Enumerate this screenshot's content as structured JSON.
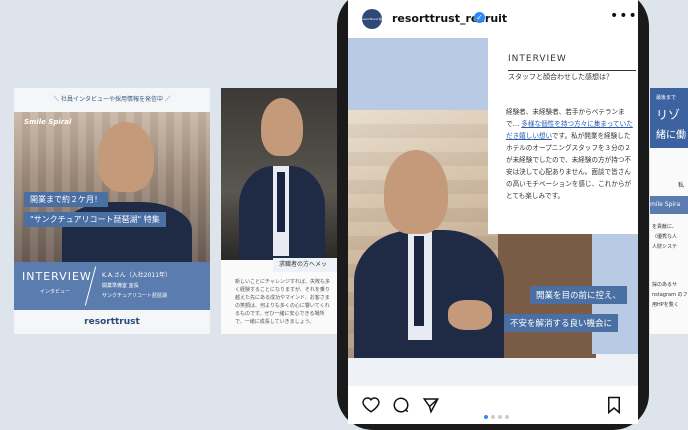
{
  "card1": {
    "top_text": "＼ 社員インタビューや採用情報を発信中 ／",
    "brand": "Smile Spiral",
    "tag1": "開業まで約２ケ月！",
    "tag2": "\"サンクチュアリコート琵琶湖\" 特集",
    "interview": "INTERVIEW",
    "interview_ja": "インタビュー",
    "person": "K.A.さん（入社2011年）",
    "dept": "開業準備室 室長",
    "hotel": "サンクチュアリコート琵琶湖",
    "logo": "resorttrust"
  },
  "card2": {
    "label": "求職者の方へメッ",
    "body": "新しいことにチャレンジすれば、失敗も多く経験することになりますが、それを乗り越えた先にある成功やマインド、お客さまの笑顔は、何よりも多くの心に響いてくれるものです。ぜひ一緒に安心できる場所で、一緒に成長していきましょう。"
  },
  "instagram": {
    "avatar_text": "resorttrust 採用",
    "username": "resorttrust_recruit",
    "verified": "✓",
    "more": "•••",
    "interview_title": "INTERVIEW",
    "interview_question": "スタッフと顔合わせした感想は？",
    "body_before": "経験者、未経験者、若手からベテランまで… ",
    "body_highlight": "多様な個性を持つ方々に集まっていただき嬉しい想い",
    "body_after": "です。私が開業を経験したホテルのオープニングスタッフを３分の２が未経験でしたので、未経験の方が持つ不安は決して心配ありません。面談で皆さんの高いモチベーションを感じ、これからがとても楽しみです。",
    "caption1": "開業を目の前に控え、",
    "caption2": "不安を解消する良い機会に",
    "icons": [
      "heart-icon",
      "comment-icon",
      "share-icon",
      "bookmark-icon"
    ]
  },
  "card3": {
    "top": "最後まで",
    "big1": "リゾ",
    "big2": "緒に働",
    "side": "私",
    "brand": "mile Spira",
    "lines": [
      "を貢献に、",
      "（優秀な人",
      "人財システ"
    ],
    "lines2": [
      "採のあるサ",
      "nstagram のフ",
      "用HPを覧く"
    ]
  }
}
